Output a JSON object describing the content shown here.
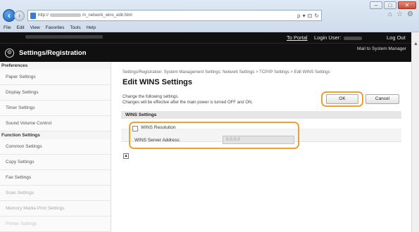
{
  "browser": {
    "url_prefix": "http://",
    "url_suffix": "m_network_wins_edit.html",
    "search_glyph": "ρ",
    "menu": [
      "File",
      "Edit",
      "View",
      "Favorites",
      "Tools",
      "Help"
    ]
  },
  "header": {
    "title": "Settings/Registration",
    "to_portal": "To Portal",
    "login_user": "Login User:",
    "log_out": "Log Out",
    "mail_to_sys": "Mail to System Manager"
  },
  "sidebar": {
    "preferences_head": "Preferences",
    "preferences": [
      "Paper Settings",
      "Display Settings",
      "Timer Settings",
      "Sound Volume Control"
    ],
    "function_head": "Function Settings",
    "functions": [
      "Common Settings",
      "Copy Settings",
      "Fax Settings",
      "Scan Settings",
      "Memory Media Print Settings",
      "Printer Settings"
    ]
  },
  "main": {
    "breadcrumb": "Settings/Registration: System Management Settings: Network Settings > TCP/IP Settings > Edit WINS Settings",
    "title": "Edit WINS Settings",
    "desc_line1": "Change the following settings.",
    "desc_line2": "Changes will be effective after the main power is turned OFF and ON.",
    "ok": "OK",
    "cancel": "Cancel",
    "section": "WINS Settings",
    "wins_resolution": "WINS Resolution",
    "server_label": "WINS Server Address:",
    "server_value": "0.0.0.0"
  },
  "colors": {
    "highlight": "#f0a030",
    "header_bg": "#101010"
  }
}
